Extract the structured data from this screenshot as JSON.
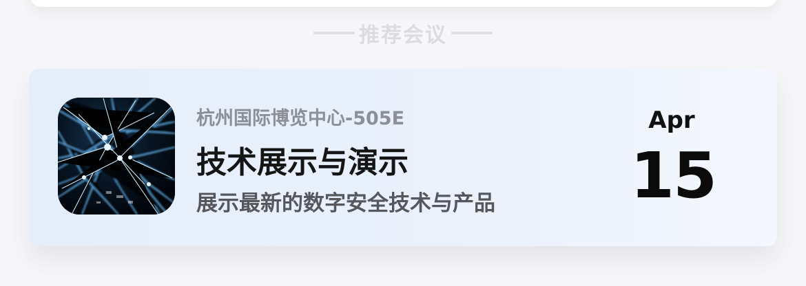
{
  "section": {
    "title": "推荐会议"
  },
  "meeting": {
    "location": "杭州国际博览中心-505E",
    "title": "技术展示与演示",
    "description": "展示最新的数字安全技术与产品",
    "date_month": "Apr",
    "date_day": "15",
    "image_icon": "network-lines-image"
  },
  "colors": {
    "card_gradient_start": "#e4eefa",
    "card_gradient_end": "#f4f7fd",
    "section_title": "#dcdce0",
    "location_text": "#8d8f96",
    "title_text": "#151515",
    "description_text": "#55575d",
    "date_text": "#111111",
    "thumbnail_lines": "#6fc3ff"
  }
}
